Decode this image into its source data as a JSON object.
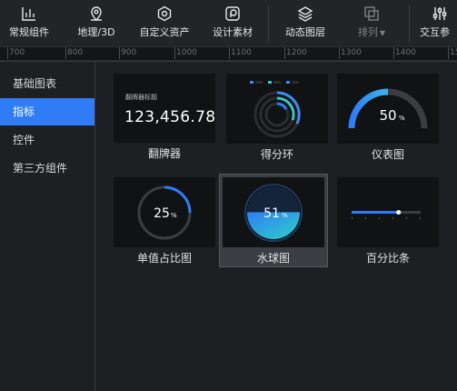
{
  "toolbar": {
    "items": [
      {
        "label": "常规组件",
        "icon": "bar-chart-icon"
      },
      {
        "label": "地理/3D",
        "icon": "map-pin-icon"
      },
      {
        "label": "自定义资产",
        "icon": "hexagon-icon"
      },
      {
        "label": "设计素材",
        "icon": "material-icon"
      },
      {
        "label": "动态图层",
        "icon": "layers-icon"
      },
      {
        "label": "排列",
        "icon": "arrange-icon"
      },
      {
        "label": "交互参",
        "icon": "sliders-icon"
      }
    ]
  },
  "ruler": {
    "ticks": [
      "700",
      "800",
      "900",
      "1000",
      "1100",
      "1200",
      "1300",
      "1400",
      "15"
    ]
  },
  "sidebar": {
    "items": [
      {
        "label": "基础图表"
      },
      {
        "label": "指标"
      },
      {
        "label": "控件"
      },
      {
        "label": "第三方组件"
      }
    ]
  },
  "cards": [
    {
      "label": "翻牌器"
    },
    {
      "label": "得分环"
    },
    {
      "label": "仪表图"
    },
    {
      "label": "单值占比图"
    },
    {
      "label": "水球图"
    },
    {
      "label": "百分比条"
    }
  ],
  "previews": {
    "flip_title": "翻牌器标题",
    "flip_value": "123,456.78",
    "gauge_value": "50",
    "gauge_unit": "%",
    "gauge_percent": 50,
    "single_value": "25",
    "single_unit": "%",
    "single_percent": 25,
    "liquid_value": "51",
    "liquid_unit": "%",
    "liquid_percent": 51,
    "percent_bar_percent": 68
  },
  "colors": {
    "accent": "#2f7cf6",
    "panel_bg": "#1d1f22",
    "thumb_bg": "#111214",
    "active_item": "#2f7cf6"
  }
}
